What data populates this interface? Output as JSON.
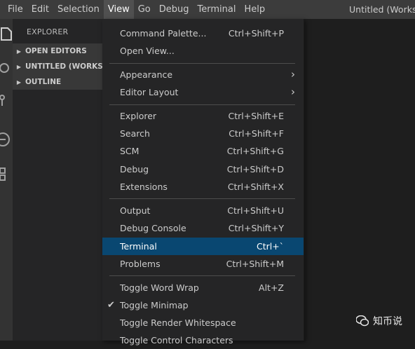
{
  "menubar": {
    "items": [
      "File",
      "Edit",
      "Selection",
      "View",
      "Go",
      "Debug",
      "Terminal",
      "Help"
    ],
    "window_title": "Untitled (Workspa"
  },
  "activitybar": {
    "icons": [
      "files-icon",
      "search-icon",
      "source-control-icon",
      "debug-icon",
      "extensions-icon"
    ]
  },
  "sidebar": {
    "title": "EXPLORER",
    "sections": [
      "OPEN EDITORS",
      "UNTITLED (WORKSPA",
      "OUTLINE"
    ]
  },
  "view_menu": {
    "command_palette": {
      "label": "Command Palette...",
      "shortcut": "Ctrl+Shift+P"
    },
    "open_view": {
      "label": "Open View..."
    },
    "appearance": {
      "label": "Appearance"
    },
    "editor_layout": {
      "label": "Editor Layout"
    },
    "explorer": {
      "label": "Explorer",
      "shortcut": "Ctrl+Shift+E"
    },
    "search": {
      "label": "Search",
      "shortcut": "Ctrl+Shift+F"
    },
    "scm": {
      "label": "SCM",
      "shortcut": "Ctrl+Shift+G"
    },
    "debug": {
      "label": "Debug",
      "shortcut": "Ctrl+Shift+D"
    },
    "extensions": {
      "label": "Extensions",
      "shortcut": "Ctrl+Shift+X"
    },
    "output": {
      "label": "Output",
      "shortcut": "Ctrl+Shift+U"
    },
    "debug_console": {
      "label": "Debug Console",
      "shortcut": "Ctrl+Shift+Y"
    },
    "terminal": {
      "label": "Terminal",
      "shortcut": "Ctrl+`"
    },
    "problems": {
      "label": "Problems",
      "shortcut": "Ctrl+Shift+M"
    },
    "toggle_word_wrap": {
      "label": "Toggle Word Wrap",
      "shortcut": "Alt+Z"
    },
    "toggle_minimap": {
      "label": "Toggle Minimap",
      "checked": true
    },
    "toggle_render_whitespace": {
      "label": "Toggle Render Whitespace"
    },
    "toggle_control_characters": {
      "label": "Toggle Control Characters"
    }
  },
  "watermark": {
    "text": "知币说"
  },
  "colors": {
    "menubar_bg": "#3c3c3c",
    "menu_bg": "#252526",
    "highlight": "#094771",
    "editor_bg": "#1e1e1e"
  }
}
